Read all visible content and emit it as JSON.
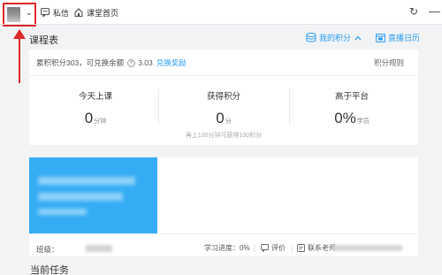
{
  "toolbar": {
    "messages_label": "私信",
    "home_label": "课堂首页",
    "refresh_icon": "refresh-icon",
    "close_icon": "close-icon"
  },
  "header": {
    "title": "课程表",
    "my_points_label": "我的积分",
    "calendar_label": "直播日历"
  },
  "points": {
    "summary": "累积积分303，可兑换余额",
    "balance": "3.03",
    "redeem_label": "兑换奖励",
    "rules_label": "积分规则",
    "stats": [
      {
        "label": "今天上课",
        "value": "0",
        "unit": "分钟"
      },
      {
        "label": "获得积分",
        "value": "0",
        "unit": "分"
      },
      {
        "label": "高于平台",
        "value": "0%",
        "unit": "学员"
      }
    ],
    "hint": "再上100分钟可获得100积分"
  },
  "course": {
    "class_label": "班级：",
    "progress_label": "学习进度：",
    "progress_value": "0%",
    "rate_label": "评价",
    "contact_label": "联系老师"
  },
  "current_task_label": "当前任务",
  "colors": {
    "accent": "#2a9cf2",
    "cover": "#35adf5",
    "highlight": "#e0292b"
  }
}
